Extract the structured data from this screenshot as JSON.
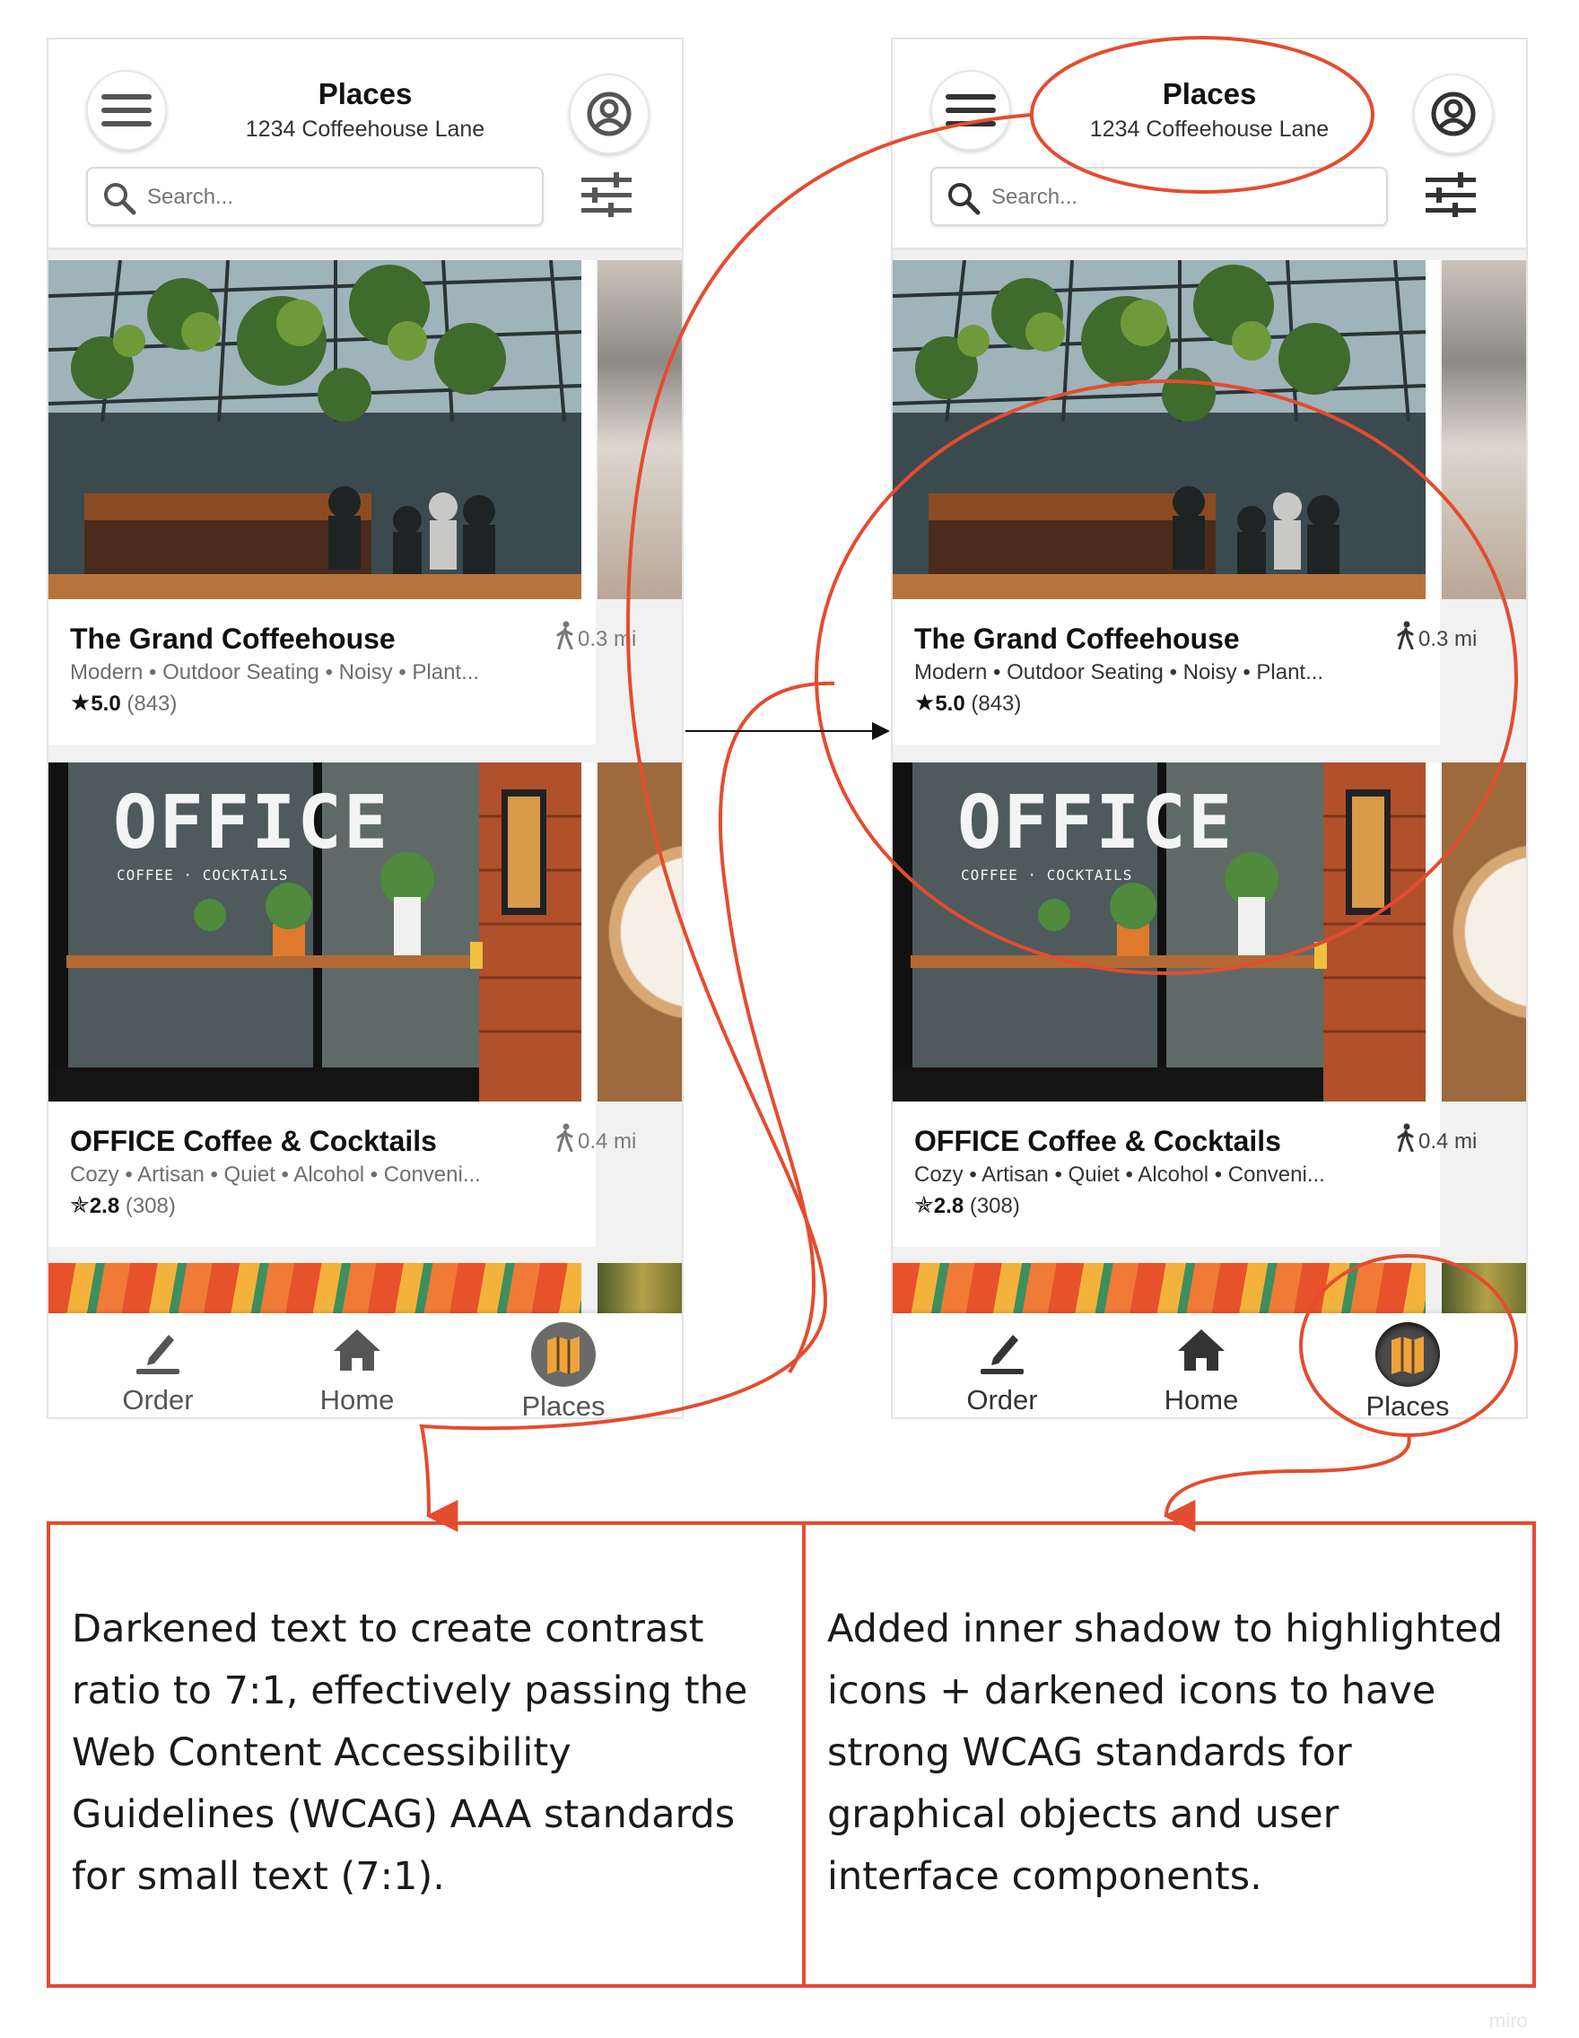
{
  "screens": [
    {
      "header": {
        "title": "Places",
        "subtitle": "1234 Coffeehouse Lane"
      },
      "search": {
        "placeholder": "Search..."
      },
      "cards": [
        {
          "name": "The Grand Coffeehouse",
          "tags": "Modern • Outdoor Seating • Noisy • Plant...",
          "rating": "5.0",
          "rating_count": "(843)",
          "distance": "0.3 mi"
        },
        {
          "name": "OFFICE Coffee & Cocktails",
          "tags": "Cozy • Artisan • Quiet • Alcohol • Conveni...",
          "rating": "2.8",
          "rating_count": "(308)",
          "distance": "0.4 mi",
          "photo_sign": "OFFICE",
          "photo_sign_sub": "COFFEE · COCKTAILS"
        }
      ],
      "nav": [
        {
          "label": "Order"
        },
        {
          "label": "Home"
        },
        {
          "label": "Places"
        }
      ]
    },
    {
      "header": {
        "title": "Places",
        "subtitle": "1234 Coffeehouse Lane"
      },
      "search": {
        "placeholder": "Search..."
      },
      "cards": [
        {
          "name": "The Grand Coffeehouse",
          "tags": "Modern • Outdoor Seating • Noisy • Plant...",
          "rating": "5.0",
          "rating_count": "(843)",
          "distance": "0.3 mi"
        },
        {
          "name": "OFFICE Coffee & Cocktails",
          "tags": "Cozy • Artisan • Quiet • Alcohol • Conveni...",
          "rating": "2.8",
          "rating_count": "(308)",
          "distance": "0.4 mi",
          "photo_sign": "OFFICE",
          "photo_sign_sub": "COFFEE · COCKTAILS"
        }
      ],
      "nav": [
        {
          "label": "Order"
        },
        {
          "label": "Home"
        },
        {
          "label": "Places"
        }
      ]
    }
  ],
  "annotations": [
    {
      "text": "Darkened text to create contrast ratio to 7:1, effectively passing the Web Content Accessibility Guidelines (WCAG) AAA standards for small text (7:1)."
    },
    {
      "text": "Added inner shadow to highlighted icons + darkened icons to have strong WCAG standards for graphical objects and user interface components."
    }
  ],
  "watermark": "miro",
  "icons": {
    "menu": "hamburger-icon",
    "profile": "account-circle-icon",
    "search": "search-icon",
    "filter": "sliders-icon",
    "walk": "walking-person-icon",
    "star": "star-icon",
    "order": "pencil-icon",
    "home": "home-icon",
    "places": "map-icon"
  },
  "colors": {
    "accent": "#e44c2f",
    "map_icon": "#f0a33a",
    "icon_dark": "#4a4a4a",
    "icon_light": "#6a6a6a"
  }
}
